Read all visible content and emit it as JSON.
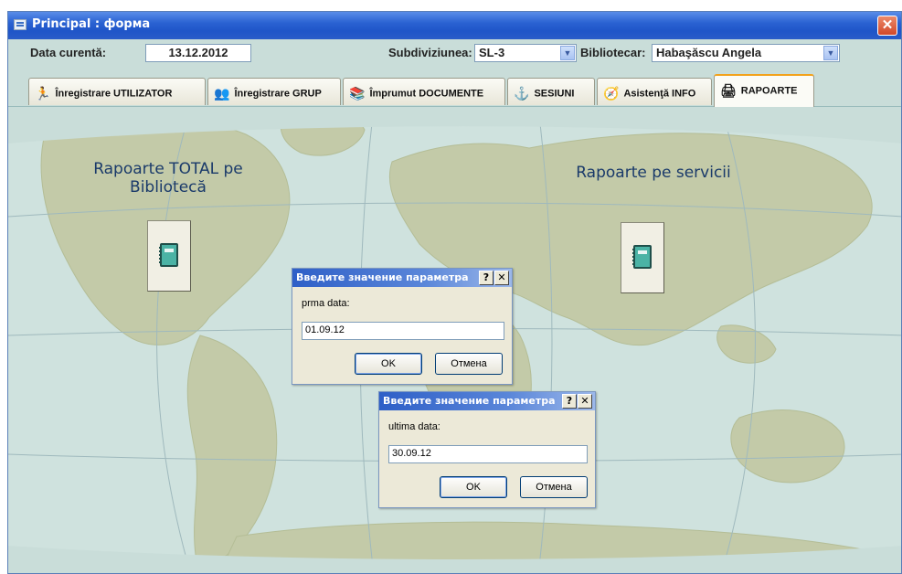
{
  "window": {
    "title": "Principal : форма",
    "close_symbol": "✕"
  },
  "toolbar": {
    "date_label": "Data curentă:",
    "date_value": "13.12.2012",
    "subdiv_label": "Subdiviziunea:",
    "subdiv_value": "SL-3",
    "lib_label": "Bibliotecar:",
    "lib_value": "Habaşăscu Angela",
    "dropdown_arrow": "▼"
  },
  "tabs": [
    {
      "label": "Înregistrare UTILIZATOR",
      "icon": "running-person-icon",
      "glyph": "🏃"
    },
    {
      "label": "Înregistrare GRUP",
      "icon": "group-icon",
      "glyph": "👥"
    },
    {
      "label": "Împrumut DOCUMENTE",
      "icon": "books-icon",
      "glyph": "📚"
    },
    {
      "label": "SESIUNI",
      "icon": "anchor-icon",
      "glyph": "⚓"
    },
    {
      "label": "Asistenţă INFO",
      "icon": "support-icon",
      "glyph": "🧭"
    },
    {
      "label": "RAPOARTE",
      "icon": "printer-icon",
      "glyph": "🖨"
    }
  ],
  "main": {
    "total_label_line1": "Rapoarte TOTAL pe",
    "total_label_line2": "Bibliotecă",
    "services_label": "Rapoarte pe servicii"
  },
  "dialogs": [
    {
      "title": "Введите значение параметра",
      "label": "prma data:",
      "value": "01.09.12",
      "ok": "OK",
      "cancel": "Отмена",
      "help": "?",
      "close": "✕"
    },
    {
      "title": "Введите значение параметра",
      "label": "ultima data:",
      "value": "30.09.12",
      "ok": "OK",
      "cancel": "Отмена",
      "help": "?",
      "close": "✕"
    }
  ],
  "colors": {
    "titlebar": "#2a62d2",
    "map_land": "#c0c8a4",
    "map_ocean": "#cfe2de",
    "accent_tab": "#f2a21c"
  }
}
